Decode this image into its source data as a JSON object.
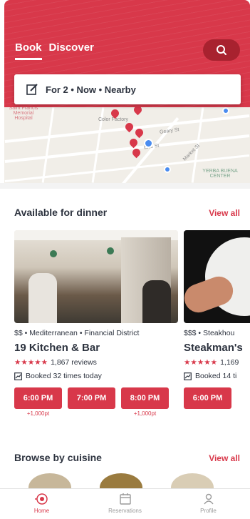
{
  "header": {
    "tabs": [
      {
        "label": "Book",
        "active": true
      },
      {
        "label": "Discover",
        "active": false
      }
    ],
    "search_icon": "search-icon",
    "accent_color": "#d8384a"
  },
  "filter": {
    "label": "For 2 • Now • Nearby",
    "icon": "edit-icon"
  },
  "map": {
    "labels": [
      "Saint Francis Memorial Hospital",
      "Color Factory",
      "Geary St",
      "Market St",
      "Ellis St",
      "YERBA BUENA CENTER"
    ]
  },
  "sections": {
    "dinner": {
      "title": "Available for dinner",
      "view_all": "View all"
    },
    "cuisine": {
      "title": "Browse by cuisine",
      "view_all": "View all"
    }
  },
  "restaurants": [
    {
      "meta": "$$ • Mediterranean • Financial District",
      "name": "19 Kitchen & Bar",
      "stars": "★★★★★",
      "reviews": "1,867 reviews",
      "booked": "Booked 32 times today",
      "slots": [
        {
          "time": "6:00 PM",
          "points": "+1,000pt"
        },
        {
          "time": "7:00 PM",
          "points": ""
        },
        {
          "time": "8:00 PM",
          "points": "+1,000pt"
        }
      ]
    },
    {
      "meta": "$$$ • Steakhou",
      "name": "Steakman's",
      "stars": "★★★★★",
      "reviews": "1,169",
      "booked": "Booked 14 ti",
      "slots": [
        {
          "time": "6:00 PM",
          "points": ""
        }
      ]
    }
  ],
  "bottom_nav": [
    {
      "label": "Home",
      "icon": "home-icon",
      "active": true
    },
    {
      "label": "Reservations",
      "icon": "calendar-icon",
      "active": false
    },
    {
      "label": "Profile",
      "icon": "profile-icon",
      "active": false
    }
  ]
}
